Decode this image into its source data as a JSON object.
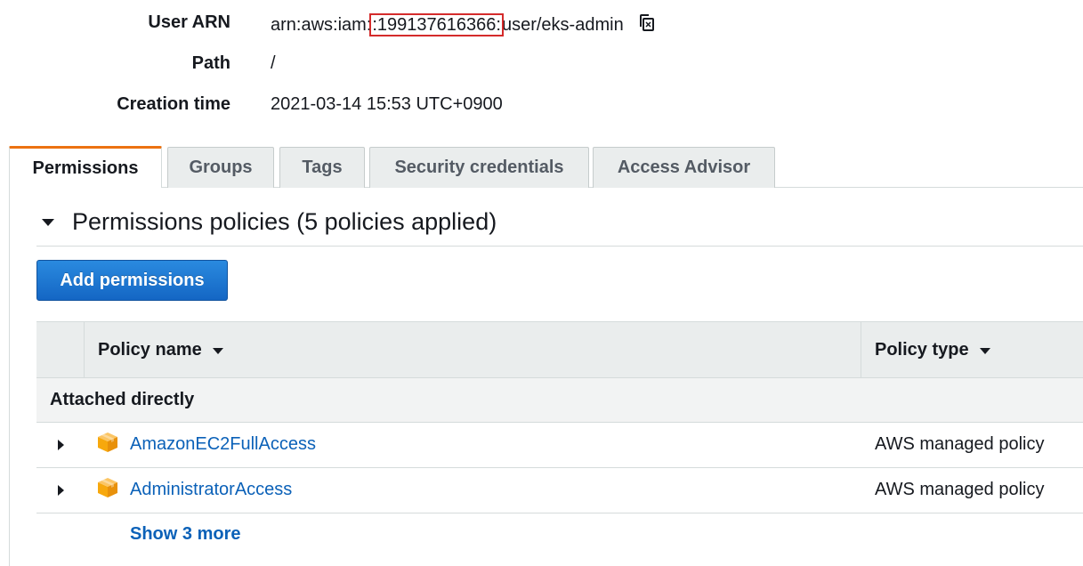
{
  "summary": {
    "user_arn_label": "User ARN",
    "user_arn_prefix": "arn:aws:iam:",
    "user_arn_account": ":199137616366:",
    "user_arn_suffix": "user/eks-admin",
    "path_label": "Path",
    "path_value": "/",
    "creation_time_label": "Creation time",
    "creation_time_value": "2021-03-14 15:53 UTC+0900",
    "copy_icon": "copy-icon"
  },
  "tabs": [
    {
      "label": "Permissions",
      "active": true
    },
    {
      "label": "Groups",
      "active": false
    },
    {
      "label": "Tags",
      "active": false
    },
    {
      "label": "Security credentials",
      "active": false
    },
    {
      "label": "Access Advisor",
      "active": false
    }
  ],
  "permissions": {
    "section_title": "Permissions policies (5 policies applied)",
    "add_button_label": "Add permissions",
    "table": {
      "columns": [
        "Policy name",
        "Policy type"
      ],
      "group_label": "Attached directly",
      "rows": [
        {
          "name": "AmazonEC2FullAccess",
          "type": "AWS managed policy",
          "icon": "aws-policy-box-icon"
        },
        {
          "name": "AdministratorAccess",
          "type": "AWS managed policy",
          "icon": "aws-policy-box-icon"
        }
      ],
      "show_more_label": "Show 3 more"
    }
  },
  "colors": {
    "accent_tab": "#ec7211",
    "link": "#0b61b8",
    "primary_button": "#1466c4",
    "highlight_box": "#d42b2b",
    "policy_icon": "#f7a80d"
  }
}
